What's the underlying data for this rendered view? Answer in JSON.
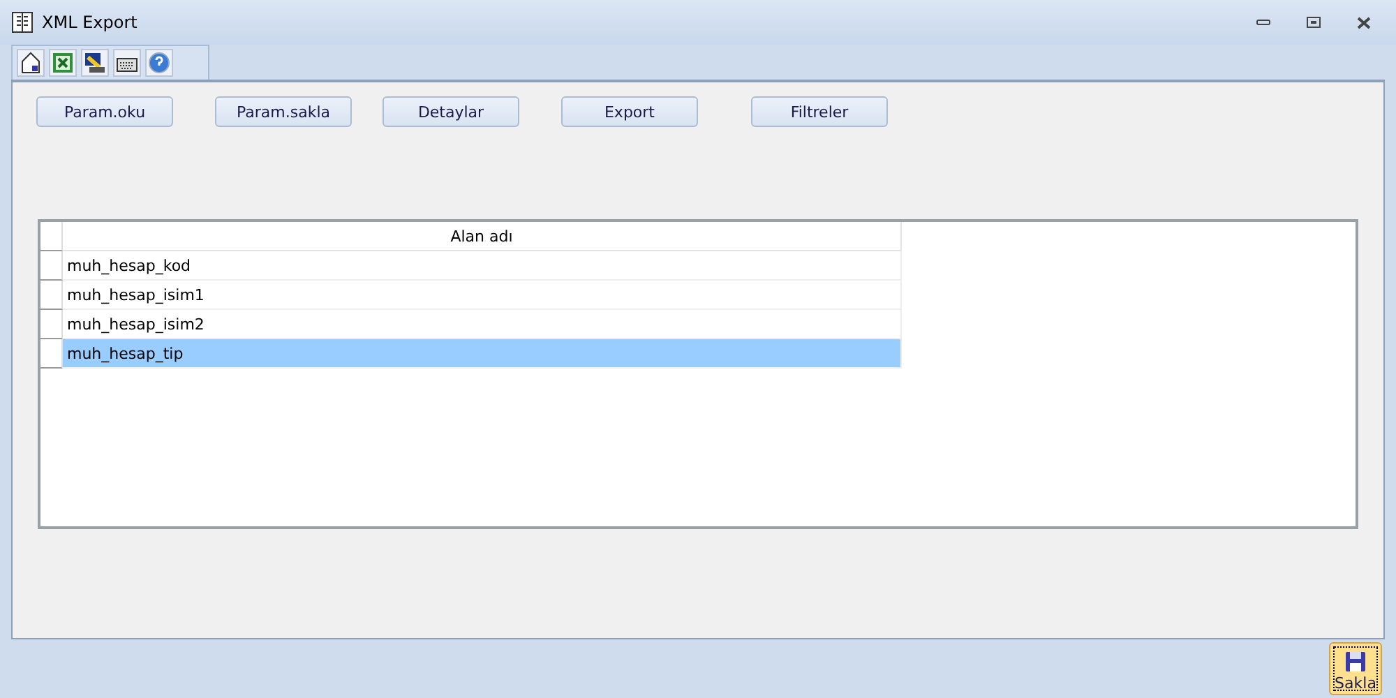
{
  "window": {
    "title": "XML Export"
  },
  "toolbar": [
    {
      "kind": "home"
    },
    {
      "kind": "excel"
    },
    {
      "kind": "settings"
    },
    {
      "kind": "keyboard"
    },
    {
      "kind": "help"
    }
  ],
  "buttons": [
    "Param.oku",
    "Param.sakla",
    "Detaylar",
    "Export",
    "Filtreler"
  ],
  "table": {
    "columns": [
      "Alan adı"
    ],
    "rows": [
      {
        "cell": "muh_hesap_kod",
        "selected": false
      },
      {
        "cell": "muh_hesap_isim1",
        "selected": false
      },
      {
        "cell": "muh_hesap_isim2",
        "selected": false
      },
      {
        "cell": "muh_hesap_tip",
        "selected": true
      }
    ]
  },
  "save_button": {
    "label": "Sakla"
  }
}
